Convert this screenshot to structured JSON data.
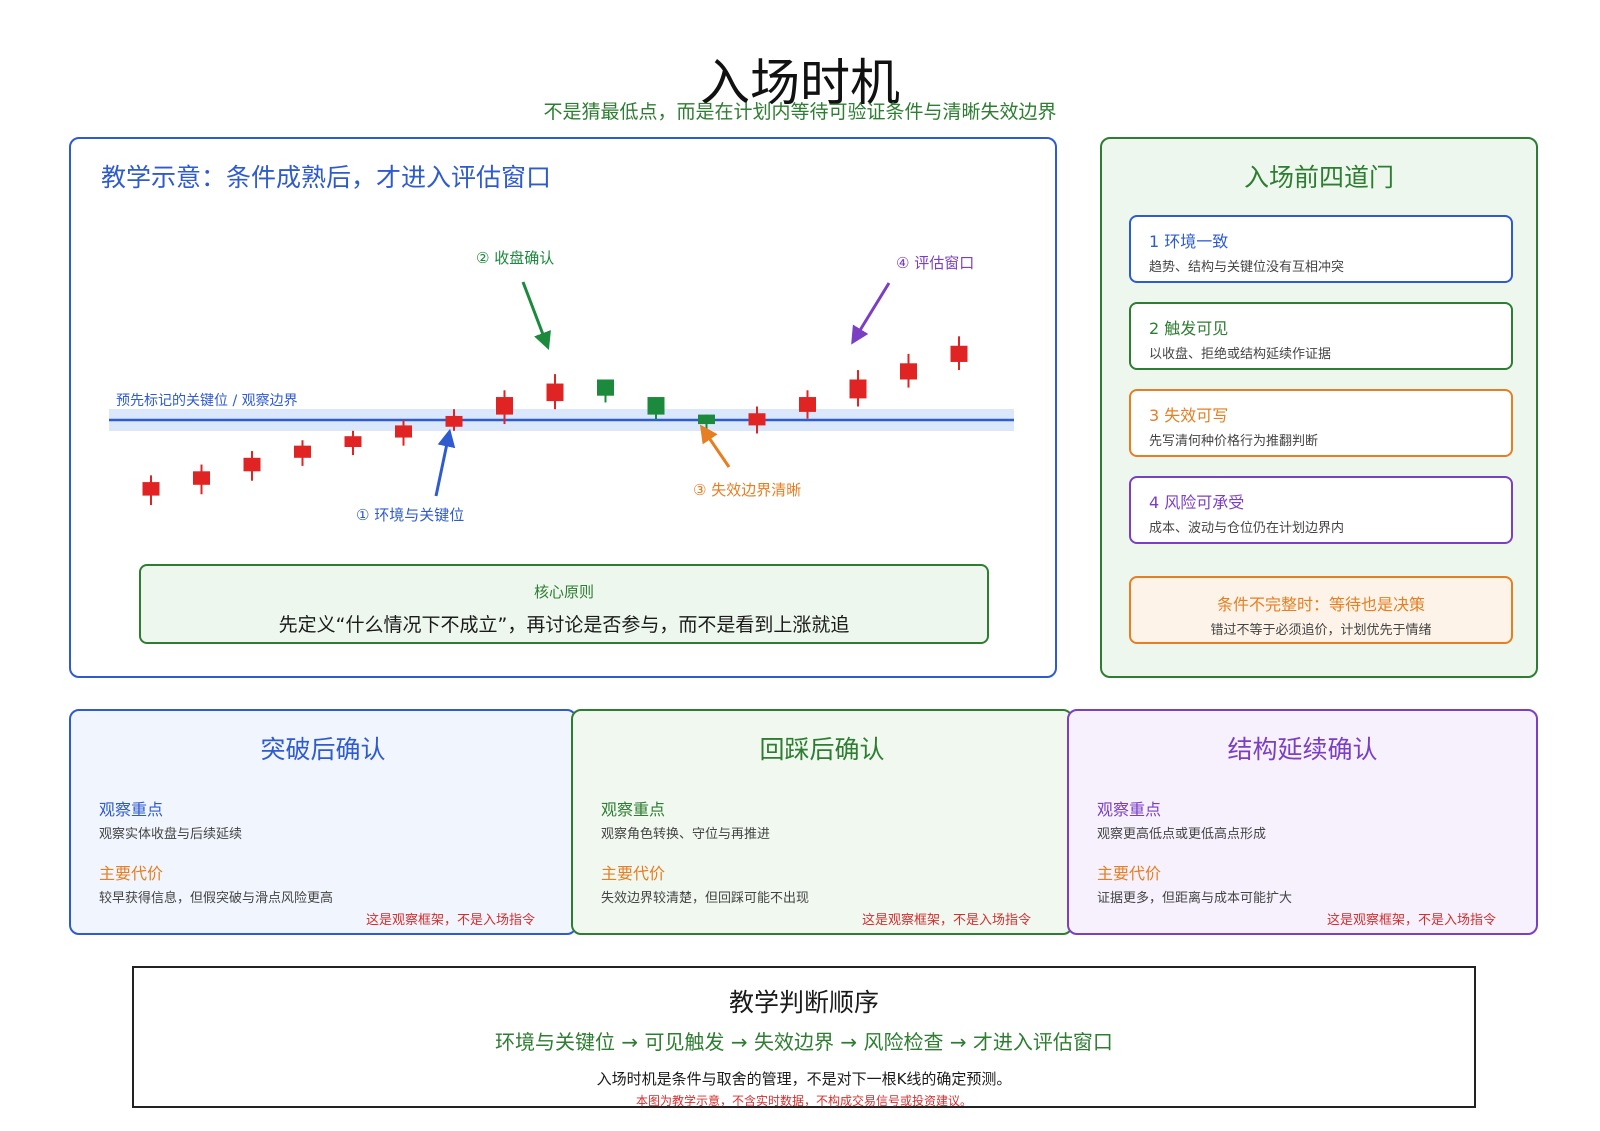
{
  "header": {
    "title": "入场时机",
    "subtitle": "不是猜最低点，而是在计划内等待可验证条件与清晰失效边界"
  },
  "chart_panel": {
    "title": "教学示意：条件成熟后，才进入评估窗口",
    "level_label": "预先标记的关键位 / 观察边界",
    "annotations": {
      "env": "① 环境与关键位",
      "close": "② 收盘确认",
      "invalid": "③ 失效边界清晰",
      "window": "④ 评估窗口"
    },
    "core_label": "核心原则",
    "core_text": "先定义“什么情况下不成立”，再讨论是否参与，而不是看到上涨就追",
    "colors": {
      "up": "#e02424",
      "down": "#1b8a3c",
      "level": "#2f5bd0",
      "band": "#dbe7fb"
    }
  },
  "chart_data": {
    "type": "candlestick",
    "y_unit": "relative price",
    "level": 0,
    "candles": [
      {
        "dir": "up",
        "open": -5.6,
        "close": -4.6,
        "high": -4.1,
        "low": -6.3
      },
      {
        "dir": "up",
        "open": -4.8,
        "close": -3.8,
        "high": -3.3,
        "low": -5.5
      },
      {
        "dir": "up",
        "open": -3.8,
        "close": -2.8,
        "high": -2.3,
        "low": -4.5
      },
      {
        "dir": "up",
        "open": -2.8,
        "close": -1.9,
        "high": -1.5,
        "low": -3.4
      },
      {
        "dir": "up",
        "open": -2.0,
        "close": -1.2,
        "high": -0.8,
        "low": -2.6
      },
      {
        "dir": "up",
        "open": -1.3,
        "close": -0.4,
        "high": 0.0,
        "low": -1.9
      },
      {
        "dir": "up",
        "open": -0.5,
        "close": 0.3,
        "high": 0.8,
        "low": -0.8
      },
      {
        "dir": "up",
        "open": 0.4,
        "close": 1.7,
        "high": 2.2,
        "low": -0.3
      },
      {
        "dir": "up",
        "open": 1.4,
        "close": 2.7,
        "high": 3.4,
        "low": 0.8
      },
      {
        "dir": "down",
        "open": 3.0,
        "close": 1.8,
        "high": 3.0,
        "low": 1.3
      },
      {
        "dir": "down",
        "open": 1.7,
        "close": 0.4,
        "high": 1.7,
        "low": 0.0
      },
      {
        "dir": "down",
        "open": 0.4,
        "close": -0.3,
        "high": 0.4,
        "low": -0.7
      },
      {
        "dir": "up",
        "open": -0.4,
        "close": 0.5,
        "high": 1.0,
        "low": -1.0
      },
      {
        "dir": "up",
        "open": 0.6,
        "close": 1.7,
        "high": 2.2,
        "low": 0.1
      },
      {
        "dir": "up",
        "open": 1.6,
        "close": 3.0,
        "high": 3.7,
        "low": 1.0
      },
      {
        "dir": "up",
        "open": 3.0,
        "close": 4.2,
        "high": 4.9,
        "low": 2.4
      },
      {
        "dir": "up",
        "open": 4.3,
        "close": 5.5,
        "high": 6.2,
        "low": 3.7
      }
    ]
  },
  "gates": {
    "title": "入场前四道门",
    "items": [
      {
        "title": "1 环境一致",
        "desc": "趋势、结构与关键位没有互相冲突",
        "color": "#2f5bd0"
      },
      {
        "title": "2 触发可见",
        "desc": "以收盘、拒绝或结构延续作证据",
        "color": "#2e7d32"
      },
      {
        "title": "3 失效可写",
        "desc": "先写清何种价格行为推翻判断",
        "color": "#e67e22"
      },
      {
        "title": "4 风险可承受",
        "desc": "成本、波动与仓位仍在计划边界内",
        "color": "#7b3fc4"
      }
    ],
    "warn_title": "条件不完整时：等待也是决策",
    "warn_desc": "错过不等于必须追价，计划优先于情绪"
  },
  "methods": [
    {
      "title": "突破后确认",
      "focus_label": "观察重点",
      "focus": "观察实体收盘与后续延续",
      "cost_label": "主要代价",
      "cost": "较早获得信息，但假突破与滑点风险更高",
      "note": "这是观察框架，不是入场指令",
      "color": "#2f5bd0",
      "bg": "#f1f5fd"
    },
    {
      "title": "回踩后确认",
      "focus_label": "观察重点",
      "focus": "观察角色转换、守位与再推进",
      "cost_label": "主要代价",
      "cost": "失效边界较清楚，但回踩可能不出现",
      "note": "这是观察框架，不是入场指令",
      "color": "#2e7d32",
      "bg": "#f0f8f0"
    },
    {
      "title": "结构延续确认",
      "focus_label": "观察重点",
      "focus": "观察更高低点或更低高点形成",
      "cost_label": "主要代价",
      "cost": "证据更多，但距离与成本可能扩大",
      "note": "这是观察框架，不是入场指令",
      "color": "#7b3fc4",
      "bg": "#f6f1fc"
    }
  ],
  "order": {
    "title": "教学判断顺序",
    "sequence": "环境与关键位 → 可见触发 → 失效边界 → 风险检查 → 才进入评估窗口",
    "text": "入场时机是条件与取舍的管理，不是对下一根K线的确定预测。",
    "note": "本图为教学示意，不含实时数据，不构成交易信号或投资建议。"
  },
  "label_color": "#e67e22"
}
